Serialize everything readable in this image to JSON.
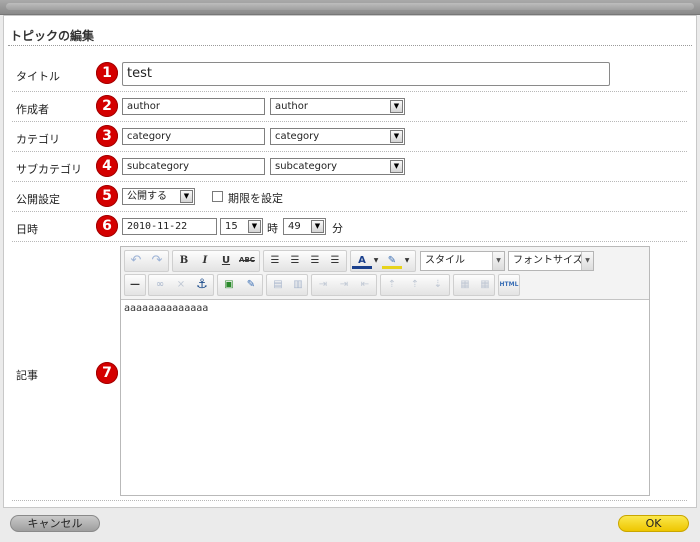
{
  "heading": "トピックの編集",
  "fields": {
    "title": {
      "label": "タイトル",
      "num": "1",
      "value": "test"
    },
    "author": {
      "label": "作成者",
      "num": "2",
      "value": "author",
      "select": "author"
    },
    "category": {
      "label": "カテゴリ",
      "num": "3",
      "value": "category",
      "select": "category"
    },
    "subcategory": {
      "label": "サブカテゴリ",
      "num": "4",
      "value": "subcategory",
      "select": "subcategory"
    },
    "publish": {
      "label": "公開設定",
      "num": "5",
      "select": "公開する",
      "checkbox_label": "期限を設定"
    },
    "datetime": {
      "label": "日時",
      "num": "6",
      "date": "2010-11-22",
      "hour": "15",
      "hour_unit": "時",
      "minute": "49",
      "minute_unit": "分"
    },
    "body": {
      "label": "記事",
      "num": "7",
      "content": "aaaaaaaaaaaaaa"
    }
  },
  "toolbar": {
    "style_select": "スタイル",
    "fontsize_select": "フォントサイズ",
    "bold": "B",
    "italic": "I",
    "underline": "U",
    "strike": "ABC",
    "html": "HTML"
  },
  "buttons": {
    "cancel": "キャンセル",
    "ok": "OK"
  },
  "colors": {
    "marker": "#d40000",
    "ok": "#f2d21a",
    "cancel": "#b3b3b3"
  }
}
